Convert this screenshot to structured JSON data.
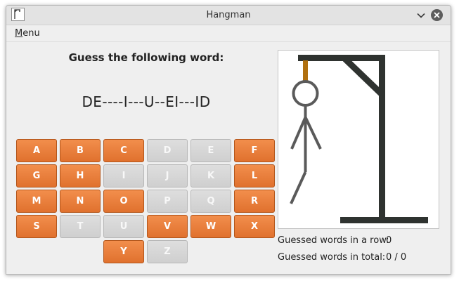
{
  "window": {
    "title": "Hangman"
  },
  "menubar": {
    "menu_label_mnemonic": "M",
    "menu_label_rest": "enu"
  },
  "game": {
    "prompt": "Guess the following word:",
    "masked_word": "DE----I---U--EI---ID"
  },
  "keyboard": {
    "keys": [
      {
        "letter": "A",
        "enabled": true
      },
      {
        "letter": "B",
        "enabled": true
      },
      {
        "letter": "C",
        "enabled": true
      },
      {
        "letter": "D",
        "enabled": false
      },
      {
        "letter": "E",
        "enabled": false
      },
      {
        "letter": "F",
        "enabled": true
      },
      {
        "letter": "G",
        "enabled": true
      },
      {
        "letter": "H",
        "enabled": true
      },
      {
        "letter": "I",
        "enabled": false
      },
      {
        "letter": "J",
        "enabled": false
      },
      {
        "letter": "K",
        "enabled": false
      },
      {
        "letter": "L",
        "enabled": true
      },
      {
        "letter": "M",
        "enabled": true
      },
      {
        "letter": "N",
        "enabled": true
      },
      {
        "letter": "O",
        "enabled": true
      },
      {
        "letter": "P",
        "enabled": false
      },
      {
        "letter": "Q",
        "enabled": false
      },
      {
        "letter": "R",
        "enabled": true
      },
      {
        "letter": "S",
        "enabled": true
      },
      {
        "letter": "T",
        "enabled": false
      },
      {
        "letter": "U",
        "enabled": false
      },
      {
        "letter": "V",
        "enabled": true
      },
      {
        "letter": "W",
        "enabled": true
      },
      {
        "letter": "X",
        "enabled": true
      },
      {
        "letter": "Y",
        "enabled": true
      },
      {
        "letter": "Z",
        "enabled": false
      }
    ],
    "enabled_color": "#e87f3c",
    "disabled_color": "#d6d6d6"
  },
  "stats": {
    "row_label": "Guessed words in a row:",
    "row_value": "0",
    "total_label": "Guessed words in total:",
    "total_value": "0 / 0"
  },
  "drawing": {
    "gallows_color": "#2f3330",
    "rope_color": "#b0700f",
    "figure_color": "#5a5a5a"
  },
  "icons": {
    "app": "hangman-app-icon",
    "minimize": "chevron-down-icon",
    "close": "close-icon"
  }
}
